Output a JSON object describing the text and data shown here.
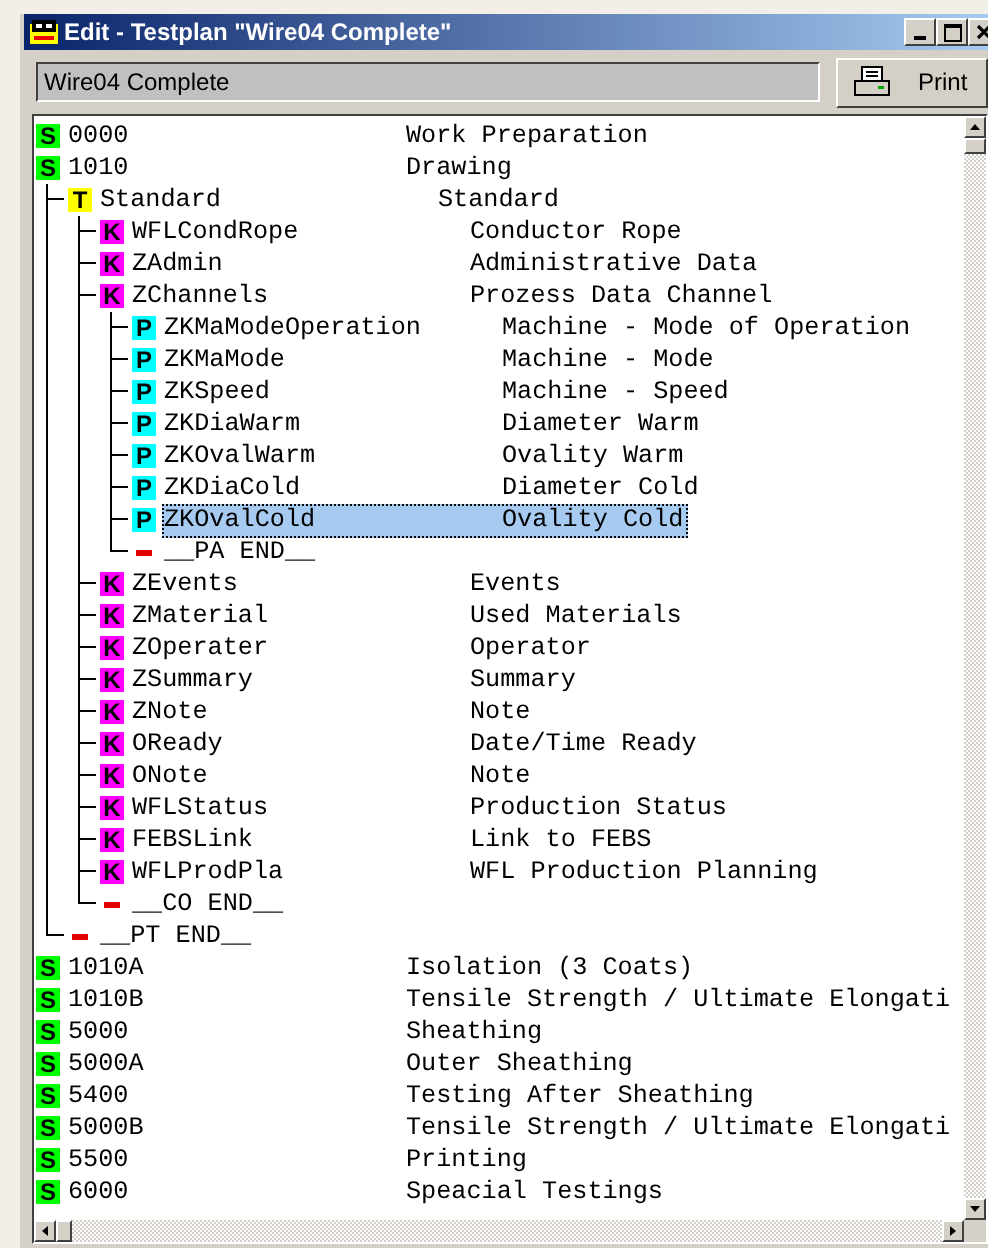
{
  "window": {
    "title": "Edit - Testplan \"Wire04 Complete\""
  },
  "toolbar": {
    "field_value": "Wire04 Complete",
    "print_button": "Print"
  },
  "tree": [
    {
      "kind": "step",
      "badge": "S",
      "code": "0000",
      "description": "Work Preparation",
      "selected": false
    },
    {
      "kind": "step",
      "badge": "S",
      "code": "1010",
      "description": "Drawing",
      "selected": false,
      "children": [
        {
          "kind": "template",
          "badge": "T",
          "code": "Standard",
          "description": "Standard",
          "selected": false,
          "children": [
            {
              "kind": "key",
              "badge": "K",
              "code": "WFLCondRope",
              "description": "Conductor Rope",
              "selected": false
            },
            {
              "kind": "key",
              "badge": "K",
              "code": "ZAdmin",
              "description": "Administrative Data",
              "selected": false
            },
            {
              "kind": "key",
              "badge": "K",
              "code": "ZChannels",
              "description": "Prozess Data Channel",
              "selected": false,
              "children": [
                {
                  "kind": "param",
                  "badge": "P",
                  "code": "ZKMaModeOperation",
                  "description": "Machine - Mode of Operation",
                  "selected": false
                },
                {
                  "kind": "param",
                  "badge": "P",
                  "code": "ZKMaMode",
                  "description": "Machine - Mode",
                  "selected": false
                },
                {
                  "kind": "param",
                  "badge": "P",
                  "code": "ZKSpeed",
                  "description": "Machine - Speed",
                  "selected": false
                },
                {
                  "kind": "param",
                  "badge": "P",
                  "code": "ZKDiaWarm",
                  "description": "Diameter Warm",
                  "selected": false
                },
                {
                  "kind": "param",
                  "badge": "P",
                  "code": "ZKOvalWarm",
                  "description": "Ovality Warm",
                  "selected": false
                },
                {
                  "kind": "param",
                  "badge": "P",
                  "code": "ZKDiaCold",
                  "description": "Diameter Cold",
                  "selected": false
                },
                {
                  "kind": "param",
                  "badge": "P",
                  "code": "ZKOvalCold",
                  "description": "Ovality Cold",
                  "selected": true
                },
                {
                  "kind": "end",
                  "code": "__PA END__",
                  "selected": false
                }
              ]
            },
            {
              "kind": "key",
              "badge": "K",
              "code": "ZEvents",
              "description": "Events",
              "selected": false
            },
            {
              "kind": "key",
              "badge": "K",
              "code": "ZMaterial",
              "description": "Used Materials",
              "selected": false
            },
            {
              "kind": "key",
              "badge": "K",
              "code": "ZOperater",
              "description": "Operator",
              "selected": false
            },
            {
              "kind": "key",
              "badge": "K",
              "code": "ZSummary",
              "description": "Summary",
              "selected": false
            },
            {
              "kind": "key",
              "badge": "K",
              "code": "ZNote",
              "description": "Note",
              "selected": false
            },
            {
              "kind": "key",
              "badge": "K",
              "code": "OReady",
              "description": "Date/Time Ready",
              "selected": false
            },
            {
              "kind": "key",
              "badge": "K",
              "code": "ONote",
              "description": "Note",
              "selected": false
            },
            {
              "kind": "key",
              "badge": "K",
              "code": "WFLStatus",
              "description": "Production Status",
              "selected": false
            },
            {
              "kind": "key",
              "badge": "K",
              "code": "FEBSLink",
              "description": "Link to FEBS",
              "selected": false
            },
            {
              "kind": "key",
              "badge": "K",
              "code": "WFLProdPla",
              "description": "WFL Production Planning",
              "selected": false
            },
            {
              "kind": "end",
              "code": "__CO END__",
              "selected": false
            }
          ]
        },
        {
          "kind": "end",
          "code": "__PT END__",
          "selected": false
        }
      ]
    },
    {
      "kind": "step",
      "badge": "S",
      "code": "1010A",
      "description": "Isolation (3 Coats)",
      "selected": false
    },
    {
      "kind": "step",
      "badge": "S",
      "code": "1010B",
      "description": "Tensile Strength / Ultimate Elongati",
      "selected": false
    },
    {
      "kind": "step",
      "badge": "S",
      "code": "5000",
      "description": "Sheathing",
      "selected": false
    },
    {
      "kind": "step",
      "badge": "S",
      "code": "5000A",
      "description": "Outer Sheathing",
      "selected": false
    },
    {
      "kind": "step",
      "badge": "S",
      "code": "5400",
      "description": "Testing After Sheathing",
      "selected": false
    },
    {
      "kind": "step",
      "badge": "S",
      "code": "5000B",
      "description": "Tensile Strength / Ultimate Elongati",
      "selected": false
    },
    {
      "kind": "step",
      "badge": "S",
      "code": "5500",
      "description": "Printing",
      "selected": false
    },
    {
      "kind": "step",
      "badge": "S",
      "code": "6000",
      "description": "Speacial Testings",
      "selected": false
    }
  ]
}
